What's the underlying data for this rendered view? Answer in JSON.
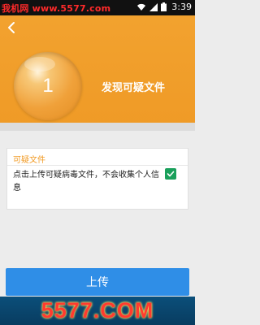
{
  "status_bar": {
    "watermark": "我机网 www.5577.com",
    "time": "3:39"
  },
  "hero": {
    "count": "1",
    "title": "发现可疑文件"
  },
  "card": {
    "title": "可疑文件",
    "description": "点击上传可疑病毒文件，不会收集个人信息",
    "checkbox_checked": true
  },
  "actions": {
    "upload_label": "上传"
  },
  "footer_banner": {
    "text": "5577.COM"
  },
  "colors": {
    "accent_orange": "#ef9a26",
    "primary_blue": "#2f8ee7",
    "check_green": "#1aa05b"
  }
}
